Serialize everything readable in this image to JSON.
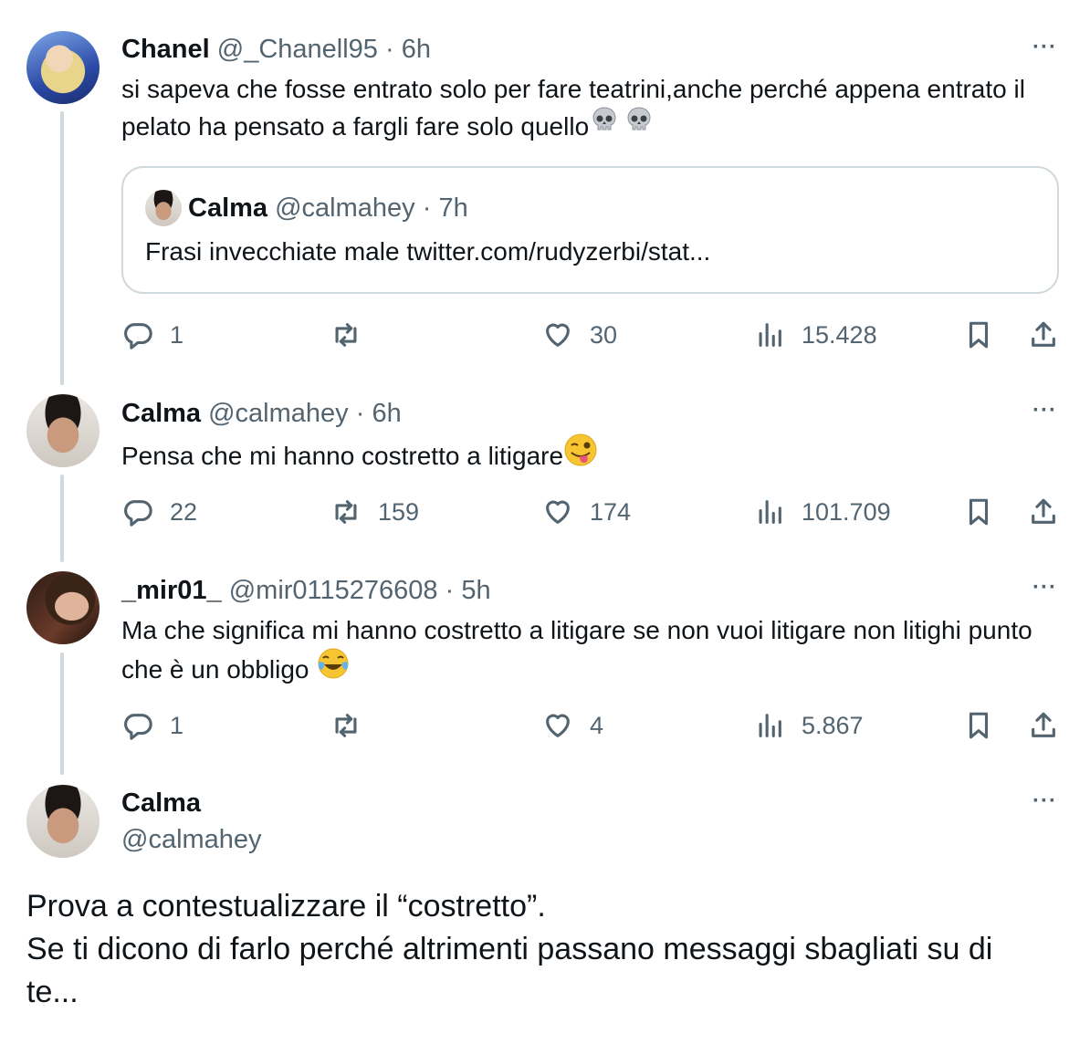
{
  "tweets": [
    {
      "name": "Chanel",
      "handle": "@_Chanell95",
      "time": "· 6h",
      "text": "si sapeva che fosse entrato solo per fare teatrini,anche perché appena entrato il pelato ha pensato a fargli fare solo quello",
      "quote": {
        "name": "Calma",
        "handle": "@calmahey",
        "time": "· 7h",
        "text": "Frasi invecchiate male twitter.com/rudyzerbi/stat..."
      },
      "replies": "1",
      "retweets": "",
      "likes": "30",
      "views": "15.428"
    },
    {
      "name": "Calma",
      "handle": "@calmahey",
      "time": "· 6h",
      "text": "Pensa che mi hanno costretto a litigare",
      "replies": "22",
      "retweets": "159",
      "likes": "174",
      "views": "101.709"
    },
    {
      "name": "_mir01_",
      "handle": "@mir0115276608",
      "time": "· 5h",
      "text": "Ma che significa mi hanno costretto a litigare se non vuoi litigare non litighi punto che è un obbligo",
      "replies": "1",
      "retweets": "",
      "likes": "4",
      "views": "5.867"
    }
  ],
  "main": {
    "name": "Calma",
    "handle": "@calmahey",
    "text_line1": "Prova a contestualizzare il “costretto”.",
    "text_line2": "Se ti dicono di farlo perché altrimenti passano messaggi sbagliati su di te..."
  },
  "ui": {
    "more": "···"
  },
  "icons": {
    "reply": "reply-icon",
    "retweet": "retweet-icon",
    "like": "heart-icon",
    "views": "views-icon",
    "bookmark": "bookmark-icon",
    "share": "share-icon"
  },
  "colors": {
    "text": "#0f1419",
    "secondary": "#536471",
    "border": "#cfd9de"
  }
}
